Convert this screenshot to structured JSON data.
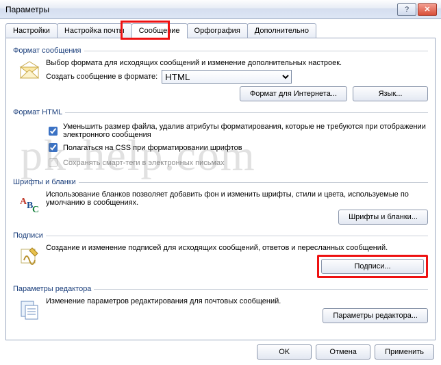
{
  "window": {
    "title": "Параметры"
  },
  "tabs": {
    "items": [
      {
        "label": "Настройки"
      },
      {
        "label": "Настройка почты"
      },
      {
        "label": "Сообщение"
      },
      {
        "label": "Орфография"
      },
      {
        "label": "Дополнительно"
      }
    ],
    "active_index": 2
  },
  "format_msg": {
    "legend": "Формат сообщения",
    "desc": "Выбор формата для исходящих сообщений и изменение дополнительных настроек.",
    "compose_label": "Создать сообщение в формате:",
    "compose_value": "HTML",
    "btn_internet": "Формат для Интернета...",
    "btn_lang": "Язык..."
  },
  "format_html": {
    "legend": "Формат HTML",
    "chk_reduce": {
      "label": "Уменьшить размер файла, удалив атрибуты форматирования, которые не требуются при отображении электронного сообщения",
      "checked": true
    },
    "chk_css": {
      "label": "Полагаться на CSS при форматировании шрифтов",
      "checked": true
    },
    "chk_smart": {
      "label": "Сохранять смарт-теги в электронных письмах",
      "checked": false,
      "disabled": true
    }
  },
  "fonts": {
    "legend": "Шрифты и бланки",
    "desc": "Использование бланков позволяет добавить фон и изменить шрифты, стили и цвета, используемые по умолчанию в сообщениях.",
    "btn": "Шрифты и бланки..."
  },
  "signatures": {
    "legend": "Подписи",
    "desc": "Создание и изменение подписей для исходящих сообщений, ответов и пересланных сообщений.",
    "btn": "Подписи..."
  },
  "editor": {
    "legend": "Параметры редактора",
    "desc": "Изменение параметров редактирования для почтовых сообщений.",
    "btn": "Параметры редактора..."
  },
  "dialog": {
    "ok": "OK",
    "cancel": "Отмена",
    "apply": "Применить"
  },
  "watermark": "pk-help.com"
}
